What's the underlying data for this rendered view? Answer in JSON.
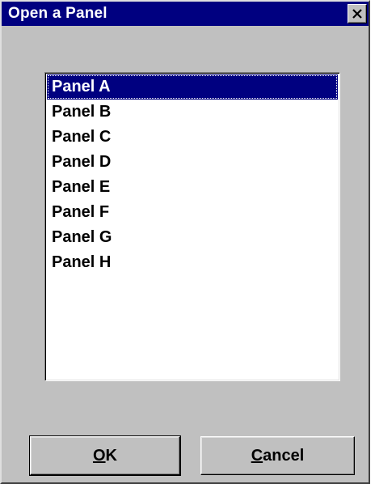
{
  "window": {
    "title": "Open a Panel"
  },
  "icons": {
    "close": "close-icon"
  },
  "list": {
    "selected_index": 0,
    "items": [
      "Panel A",
      "Panel B",
      "Panel C",
      "Panel D",
      "Panel E",
      "Panel F",
      "Panel G",
      "Panel H"
    ]
  },
  "buttons": {
    "ok": {
      "mnemonic": "O",
      "rest": "K"
    },
    "cancel": {
      "mnemonic": "C",
      "rest": "ancel"
    }
  },
  "colors": {
    "titlebar": "#000080",
    "face": "#c0c0c0",
    "selection": "#000080"
  }
}
